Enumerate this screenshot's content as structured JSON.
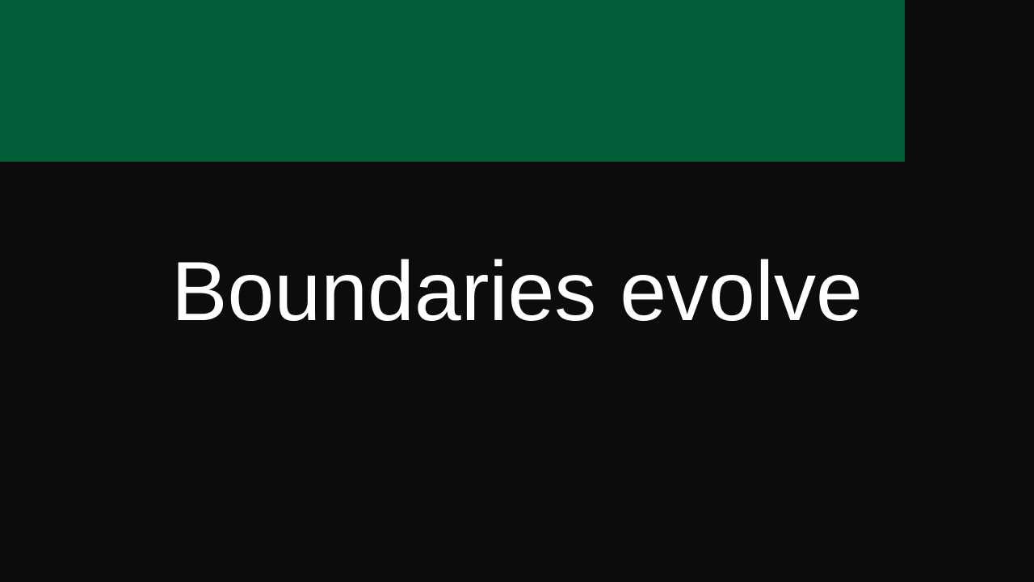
{
  "slide": {
    "headline": "Boundaries evolve"
  },
  "colors": {
    "background": "#0c0c0c",
    "accent_band": "#025e38",
    "text": "#ffffff"
  }
}
